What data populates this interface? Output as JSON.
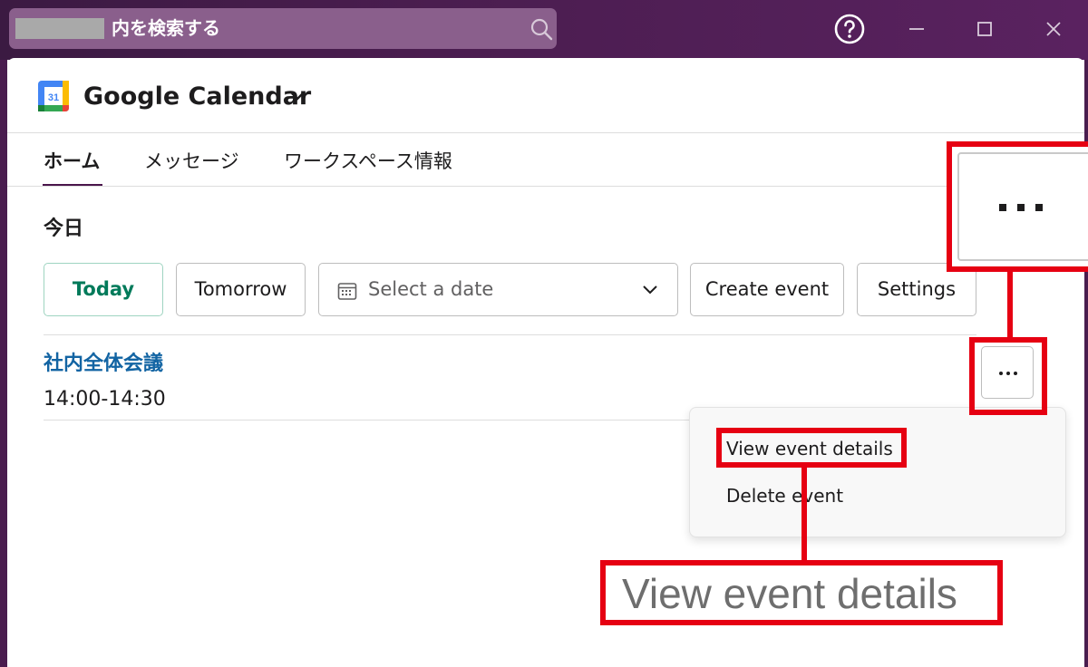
{
  "titlebar": {
    "search_placeholder": "内を検索する",
    "icons": [
      "search-icon",
      "help-icon",
      "minimize-icon",
      "maximize-icon",
      "close-icon"
    ]
  },
  "header": {
    "app_title": "Google Calendar",
    "logo_text": "31"
  },
  "tabs": [
    {
      "label": "ホーム",
      "active": true
    },
    {
      "label": "メッセージ",
      "active": false
    },
    {
      "label": "ワークスペース情報",
      "active": false
    }
  ],
  "section": {
    "heading": "今日"
  },
  "toolbar": {
    "today_label": "Today",
    "tomorrow_label": "Tomorrow",
    "date_placeholder": "Select a date",
    "create_label": "Create event",
    "settings_label": "Settings"
  },
  "event": {
    "title": "社内全体会議",
    "time": "14:00-14:30"
  },
  "menu": {
    "view_label": "View event details",
    "delete_label": "Delete event"
  },
  "annotation": {
    "zoom_label": "View event details"
  },
  "colors": {
    "titlebar": "#4a1d4f",
    "accent_green": "#007a5a",
    "link_blue": "#1264a3",
    "annotation_red": "#e60012"
  }
}
